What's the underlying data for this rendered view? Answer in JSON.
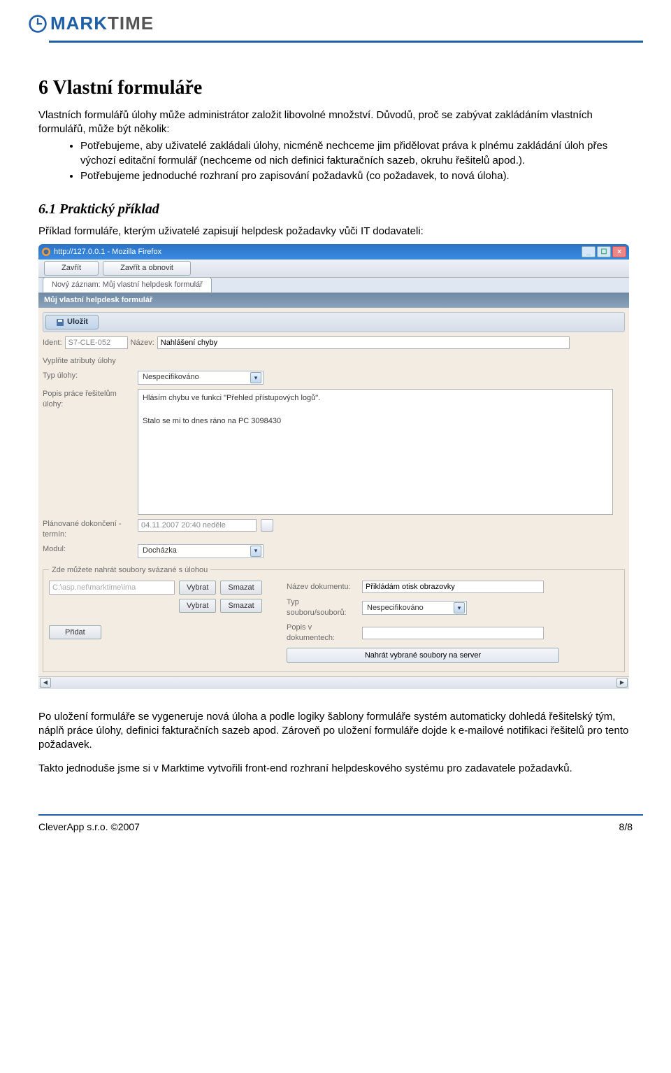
{
  "header": {
    "logo_mark": "MARK",
    "logo_time": "TIME"
  },
  "doc": {
    "h1": "6  Vlastní formuláře",
    "intro_p1": "Vlastních formulářů úlohy může administrátor založit libovolné množství. Důvodů, proč se zabývat zakládáním vlastních formulářů, může být několik:",
    "bullets": [
      "Potřebujeme, aby uživatelé zakládali úlohy, nicméně nechceme jim přidělovat práva k plnému zakládání úloh přes výchozí editační formulář (nechceme od nich definici fakturačních sazeb, okruhu řešitelů apod.).",
      "Potřebujeme jednoduché rozhraní pro zapisování požadavků (co požadavek, to nová úloha)."
    ],
    "h2": "6.1  Praktický příklad",
    "h2_sub": "Příklad formuláře, kterým uživatelé zapisují helpdesk požadavky vůči IT dodavateli:"
  },
  "screenshot": {
    "win_title": "http://127.0.0.1 - Mozilla Firefox",
    "toolbar": {
      "close": "Zavřít",
      "close_refresh": "Zavřít a obnovit"
    },
    "tab": "Nový záznam: Můj vlastní helpdesk formulář",
    "form_title": "Můj vlastní helpdesk formulář",
    "save_btn": "Uložit",
    "ident_lbl": "Ident:",
    "ident_val": "S7-CLE-052",
    "nazev_lbl": "Název:",
    "nazev_val": "Nahlášení chyby",
    "section_attributes": "Vyplňte atributy úlohy",
    "typ_ulohy_lbl": "Typ úlohy:",
    "typ_ulohy_val": "Nespecifikováno",
    "popis_lbl": "Popis práce řešitelům úlohy:",
    "popis_line1": "Hlásím chybu ve funkci \"Přehled přístupových logů\".",
    "popis_line2": "Stalo se mi to dnes ráno na PC 3098430",
    "plan_lbl": "Plánované dokončení - termín:",
    "plan_val": "04.11.2007 20:40 neděle",
    "modul_lbl": "Modul:",
    "modul_val": "Docházka",
    "upload_legend": "Zde můžete nahrát soubory svázané s úlohou",
    "path_val": "C:\\asp.net\\marktime\\ima",
    "vybrat": "Vybrat",
    "smazat": "Smazat",
    "pridat": "Přidat",
    "nazev_dok_lbl": "Název dokumentu:",
    "nazev_dok_val": "Přikládám otisk obrazovky",
    "typ_soub_lbl": "Typ souboru/souborů:",
    "typ_soub_val": "Nespecifikováno",
    "popis_dok_lbl": "Popis v dokumentech:",
    "upload_btn": "Nahrát vybrané soubory na server"
  },
  "after": {
    "p1": "Po uložení formuláře se vygeneruje nová úloha a podle logiky šablony formuláře systém automaticky dohledá řešitelský tým, náplň práce úlohy, definici fakturačních sazeb apod. Zároveň po uložení formuláře dojde k e-mailové notifikaci řešitelů pro tento požadavek.",
    "p2": "Takto jednoduše jsme si v Marktime vytvořili front-end rozhraní helpdeskového systému pro zadavatele požadavků."
  },
  "footer": {
    "left": "CleverApp s.r.o. ©2007",
    "right": "8/8"
  }
}
